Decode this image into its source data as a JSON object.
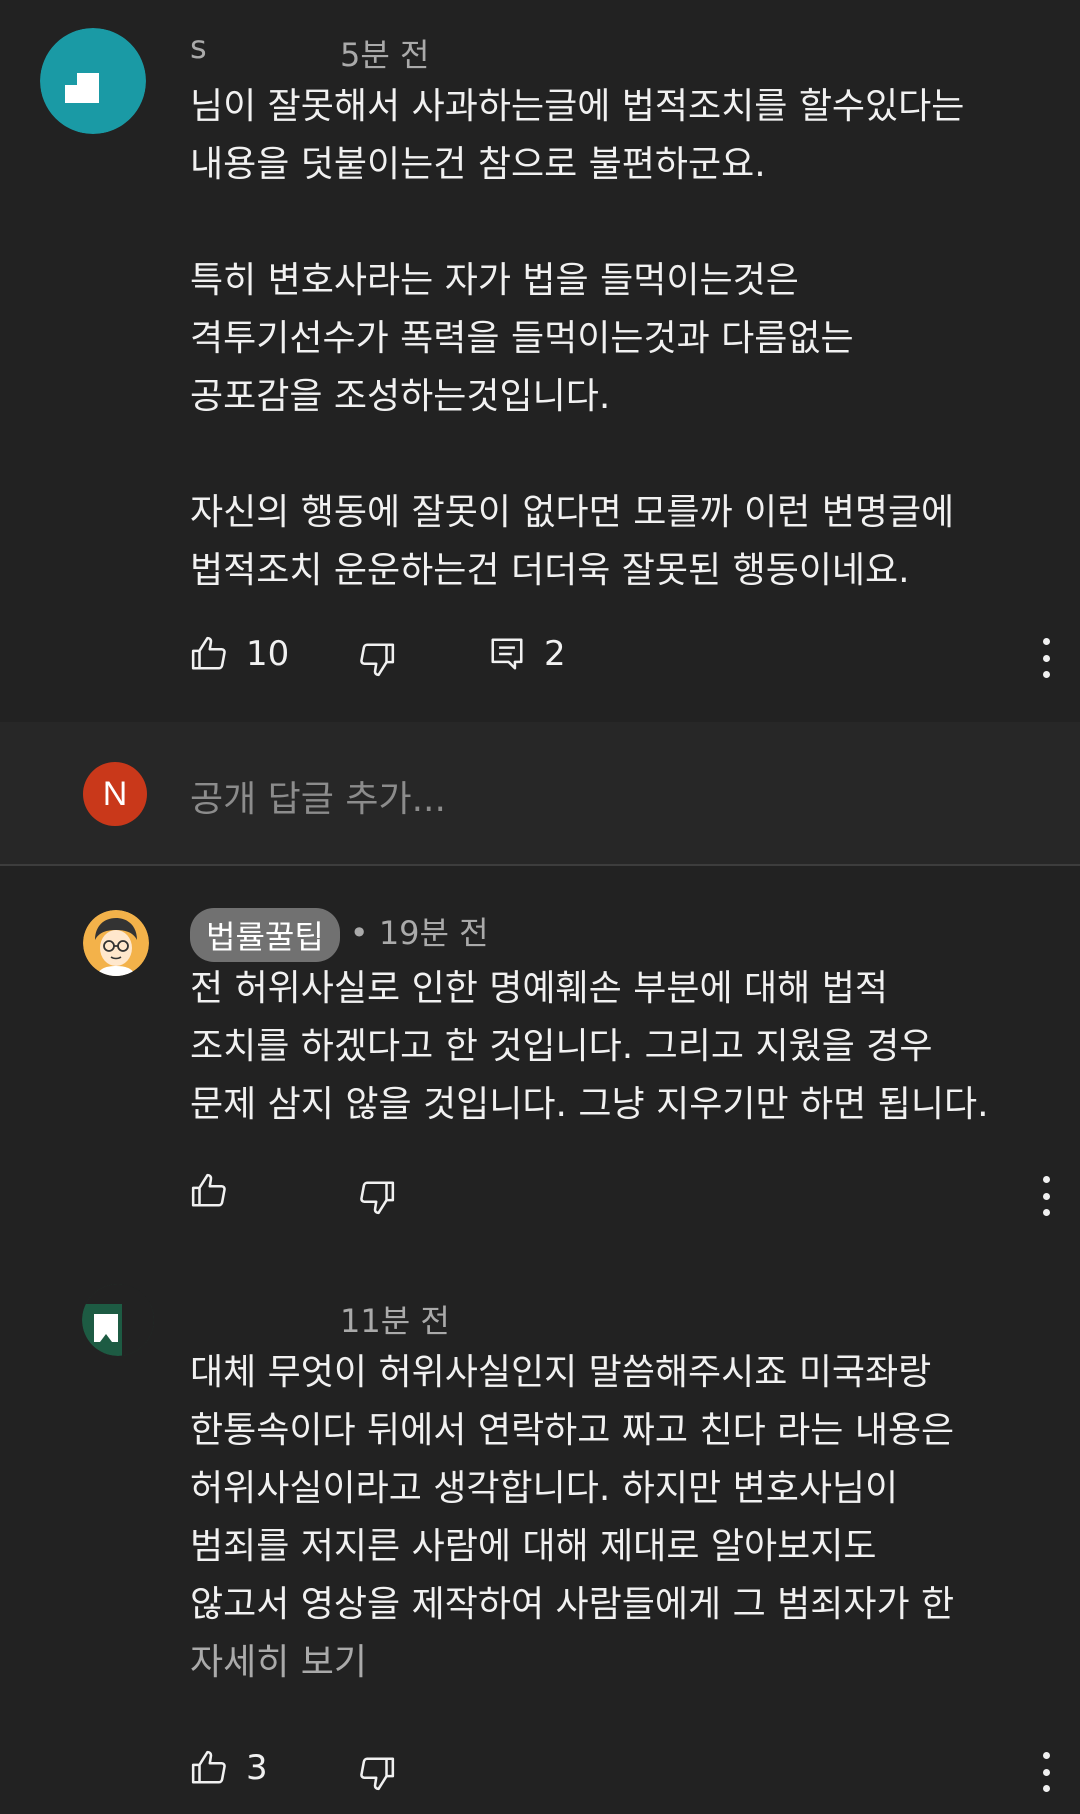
{
  "comments": [
    {
      "author": "s",
      "time": "5분 전",
      "paragraphs": [
        [
          "님이 잘못해서 사과하는글에 법적조치를 할수있다는",
          "내용을 덧붙이는건 참으로 불편하군요."
        ],
        [
          "특히 변호사라는 자가 법을 들먹이는것은",
          "격투기선수가 폭력을 들먹이는것과 다름없는",
          "공포감을 조성하는것입니다."
        ],
        [
          "자신의 행동에 잘못이 없다면 모를까 이런 변명글에",
          "법적조치 운운하는건 더더욱 잘못된 행동이네요."
        ]
      ],
      "likes": "10",
      "replies": "2"
    },
    {
      "author": "법률꿀팁",
      "time": "• 19분 전",
      "paragraphs": [
        [
          "전 허위사실로 인한 명예훼손 부분에 대해 법적",
          "조치를 하겠다고 한 것입니다. 그리고  지웠을 경우",
          "문제 삼지 않을 것입니다. 그냥 지우기만 하면 됩니다."
        ]
      ]
    },
    {
      "author": "",
      "time": "11분 전",
      "paragraphs": [
        [
          "대체 무엇이 허위사실인지 말씀해주시죠 미국좌랑",
          "한통속이다 뒤에서 연락하고 짜고 친다 라는 내용은",
          "허위사실이라고 생각합니다. 하지만 변호사님이",
          "범죄를 저지른 사람에 대해 제대로 알아보지도",
          "않고서 영상을 제작하여 사람들에게 그 범죄자가 한"
        ]
      ],
      "see_more": "자세히 보기",
      "likes": "3"
    }
  ],
  "reply_bar": {
    "avatar_letter": "N",
    "placeholder": "공개 답글 추가..."
  },
  "colors": {
    "background": "#222222",
    "reply_bar": "#272727",
    "text": "#f1f1f1",
    "meta": "#aaaaaa",
    "avatar_n": "#c9381a",
    "avatar_teal": "#1a9aa5",
    "avatar_green": "#1d5b43"
  },
  "icons": [
    "like-icon",
    "dislike-icon",
    "reply-icon",
    "more-vert-icon"
  ]
}
